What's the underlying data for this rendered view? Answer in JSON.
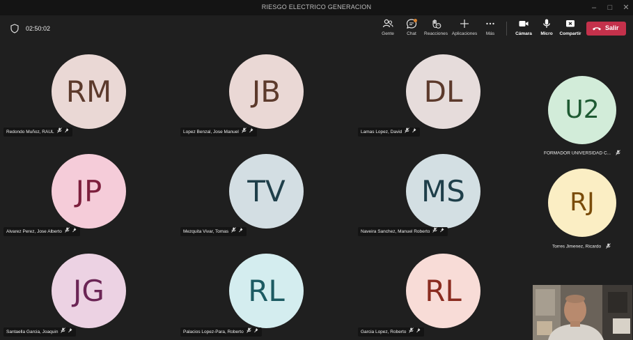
{
  "window": {
    "title": "RIESGO ELECTRICO GENERACION"
  },
  "meeting": {
    "timer": "02:50:02"
  },
  "toolbar": {
    "people": "Gente",
    "chat": "Chat",
    "reactions": "Reacciones",
    "apps": "Aplicaciones",
    "more": "Más",
    "camera": "Cámara",
    "mic": "Micro",
    "share": "Compartir",
    "leave": "Salir"
  },
  "participants": [
    {
      "initials": "RM",
      "name": "Redondo Muñoz, RAUL",
      "bg": "#ead8d5",
      "fg": "#5c3a2c"
    },
    {
      "initials": "JB",
      "name": "Lopez Benzal, Jose Manuel",
      "bg": "#ead8d5",
      "fg": "#5c3a2c"
    },
    {
      "initials": "DL",
      "name": "Lamas Lopez, David",
      "bg": "#e6dcdb",
      "fg": "#5c3a2c"
    },
    {
      "initials": "JP",
      "name": "Alvarez Perez, Jose Alberto",
      "bg": "#f5ccd9",
      "fg": "#7c1f3d"
    },
    {
      "initials": "TV",
      "name": "Mezquita Vivar, Tomas",
      "bg": "#d3dee3",
      "fg": "#1f3f4a"
    },
    {
      "initials": "MS",
      "name": "Naveira Sanchez, Manuel Roberto",
      "bg": "#d3dfe3",
      "fg": "#1f3f4a"
    },
    {
      "initials": "JG",
      "name": "Santaella Garcia, Joaquin",
      "bg": "#ecd2e3",
      "fg": "#6b2555"
    },
    {
      "initials": "RL",
      "name": "Palacios Lopez-Para, Roberto",
      "bg": "#d4edef",
      "fg": "#1c5a62"
    },
    {
      "initials": "RL",
      "name": "Garcia Lopez, Roberto",
      "bg": "#f8dcd7",
      "fg": "#8a2c20"
    }
  ],
  "side_participants": [
    {
      "initials": "U2",
      "name": "FORMADOR UNIVERSIDAD C...",
      "bg": "#d2ecd9",
      "fg": "#1e5a32"
    },
    {
      "initials": "RJ",
      "name": "Torres Jimenez, Ricardo",
      "bg": "#fbeec4",
      "fg": "#7a4c0a"
    }
  ]
}
